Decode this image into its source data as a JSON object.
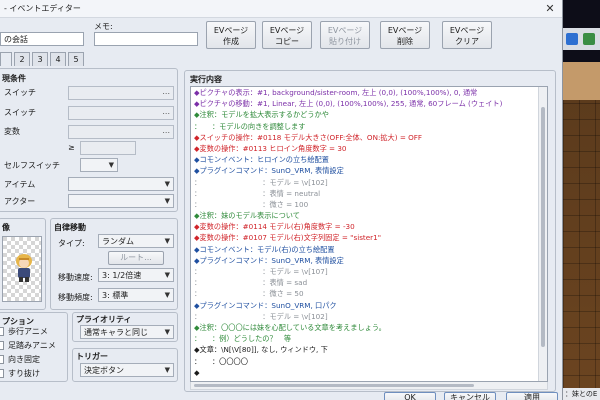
{
  "window": {
    "title": "- イベントエディター",
    "close_glyph": "✕"
  },
  "header": {
    "name_value": "の会話",
    "memo_label": "メモ:",
    "memo_value": ""
  },
  "ev_buttons": [
    {
      "line1": "EVページ",
      "line2": "作成",
      "enabled": true
    },
    {
      "line1": "EVページ",
      "line2": "コピー",
      "enabled": true
    },
    {
      "line1": "EVページ",
      "line2": "貼り付け",
      "enabled": false
    },
    {
      "line1": "EVページ",
      "line2": "削除",
      "enabled": true
    },
    {
      "line1": "EVページ",
      "line2": "クリア",
      "enabled": true
    }
  ],
  "page_tabs": [
    "",
    "2",
    "3",
    "4",
    "5"
  ],
  "conditions": {
    "title": "現条件",
    "switch1": "スイッチ",
    "switch2": "スイッチ",
    "variable": "変数",
    "gte": "≥",
    "self_switch": "セルフスイッチ",
    "item": "アイテム",
    "actor": "アクター",
    "picker_dots": "..."
  },
  "image_section": {
    "title": "像"
  },
  "autonomous": {
    "title": "自律移動",
    "type_label": "タイプ:",
    "type_value": "ランダム",
    "route_button": "ルート...",
    "speed_label": "移動速度:",
    "speed_value": "3: 1/2倍速",
    "freq_label": "移動頻度:",
    "freq_value": "3: 標準"
  },
  "options": {
    "title": "プション",
    "items": [
      "歩行アニメ",
      "足踏みアニメ",
      "向き固定",
      "すり抜け"
    ]
  },
  "priority": {
    "title": "プライオリティ",
    "value": "通常キャラと同じ"
  },
  "trigger": {
    "title": "トリガー",
    "value": "決定ボタン"
  },
  "commands": {
    "title": "実行内容",
    "lines": [
      {
        "text": "◆ピクチャの表示：#1, background/sister-room, 左上 (0,0), (100%,100%), 0, 通常",
        "color": "#7b2fa8"
      },
      {
        "text": "◆ピクチャの移動：#1, Linear, 左上 (0,0), (100%,100%), 255, 通常, 60フレーム (ウェイト)",
        "color": "#7b2fa8"
      },
      {
        "text": "◆注釈：モデルを拡大表示するかどうかや",
        "color": "#2f8a3a"
      },
      {
        "text": "：　　：モデルの向きを調整します",
        "color": "#2f8a3a"
      },
      {
        "text": "◆スイッチの操作：#0118 モデル大きさ(OFF:全体、ON:拡大) = OFF",
        "color": "#d0242a"
      },
      {
        "text": "◆変数の操作：#0113 ヒロイン角度数字 = 30",
        "color": "#d0242a"
      },
      {
        "text": "◆コモンイベント：ヒロインの立ち絵配置",
        "color": "#1f4fa0"
      },
      {
        "text": "◆プラグインコマンド：SunO_VRM, 表情設定",
        "color": "#1f4fa0"
      },
      {
        "text": "：　　　　　　　　　：モデル = \\v[102]",
        "color": "#8a8f96"
      },
      {
        "text": "：　　　　　　　　　：表情 = neutral",
        "color": "#8a8f96"
      },
      {
        "text": "：　　　　　　　　　：微さ = 100",
        "color": "#8a8f96"
      },
      {
        "text": "◆注釈：妹のモデル表示について",
        "color": "#2f8a3a"
      },
      {
        "text": "◆変数の操作：#0114 モデル(右)角度数字 = -30",
        "color": "#d0242a"
      },
      {
        "text": "◆変数の操作：#0107 モデル(右)文字列固定 = \"sister1\"",
        "color": "#d0242a"
      },
      {
        "text": "◆コモンイベント：モデル(右)の立ち絵配置",
        "color": "#1f4fa0"
      },
      {
        "text": "◆プラグインコマンド：SunO_VRM, 表情設定",
        "color": "#1f4fa0"
      },
      {
        "text": "：　　　　　　　　　：モデル = \\v[107]",
        "color": "#8a8f96"
      },
      {
        "text": "：　　　　　　　　　：表情 = sad",
        "color": "#8a8f96"
      },
      {
        "text": "：　　　　　　　　　：微さ = 50",
        "color": "#8a8f96"
      },
      {
        "text": "◆プラグインコマンド：SunO_VRM, 口パク",
        "color": "#1f4fa0"
      },
      {
        "text": "：　　　　　　　　　：モデル = \\v[102]",
        "color": "#8a8f96"
      },
      {
        "text": "◆注釈：〇〇〇には妹を心配している文章を考えましょう。",
        "color": "#2f8a3a"
      },
      {
        "text": "：　　：例）どうしたの？　等",
        "color": "#2f8a3a"
      },
      {
        "text": "◆文章：\\N[\\V[80]], なし, ウィンドウ, 下",
        "color": "#1b1b1b"
      },
      {
        "text": "：　　：〇〇〇〇",
        "color": "#1b1b1b"
      },
      {
        "text": "◆",
        "color": "#1b1b1b"
      }
    ]
  },
  "dialog_buttons": [
    "OK",
    "キャンセル",
    "適用"
  ],
  "background": {
    "status_text": "：妹とのE"
  },
  "colors": {
    "accent": "#6f8fbf"
  }
}
